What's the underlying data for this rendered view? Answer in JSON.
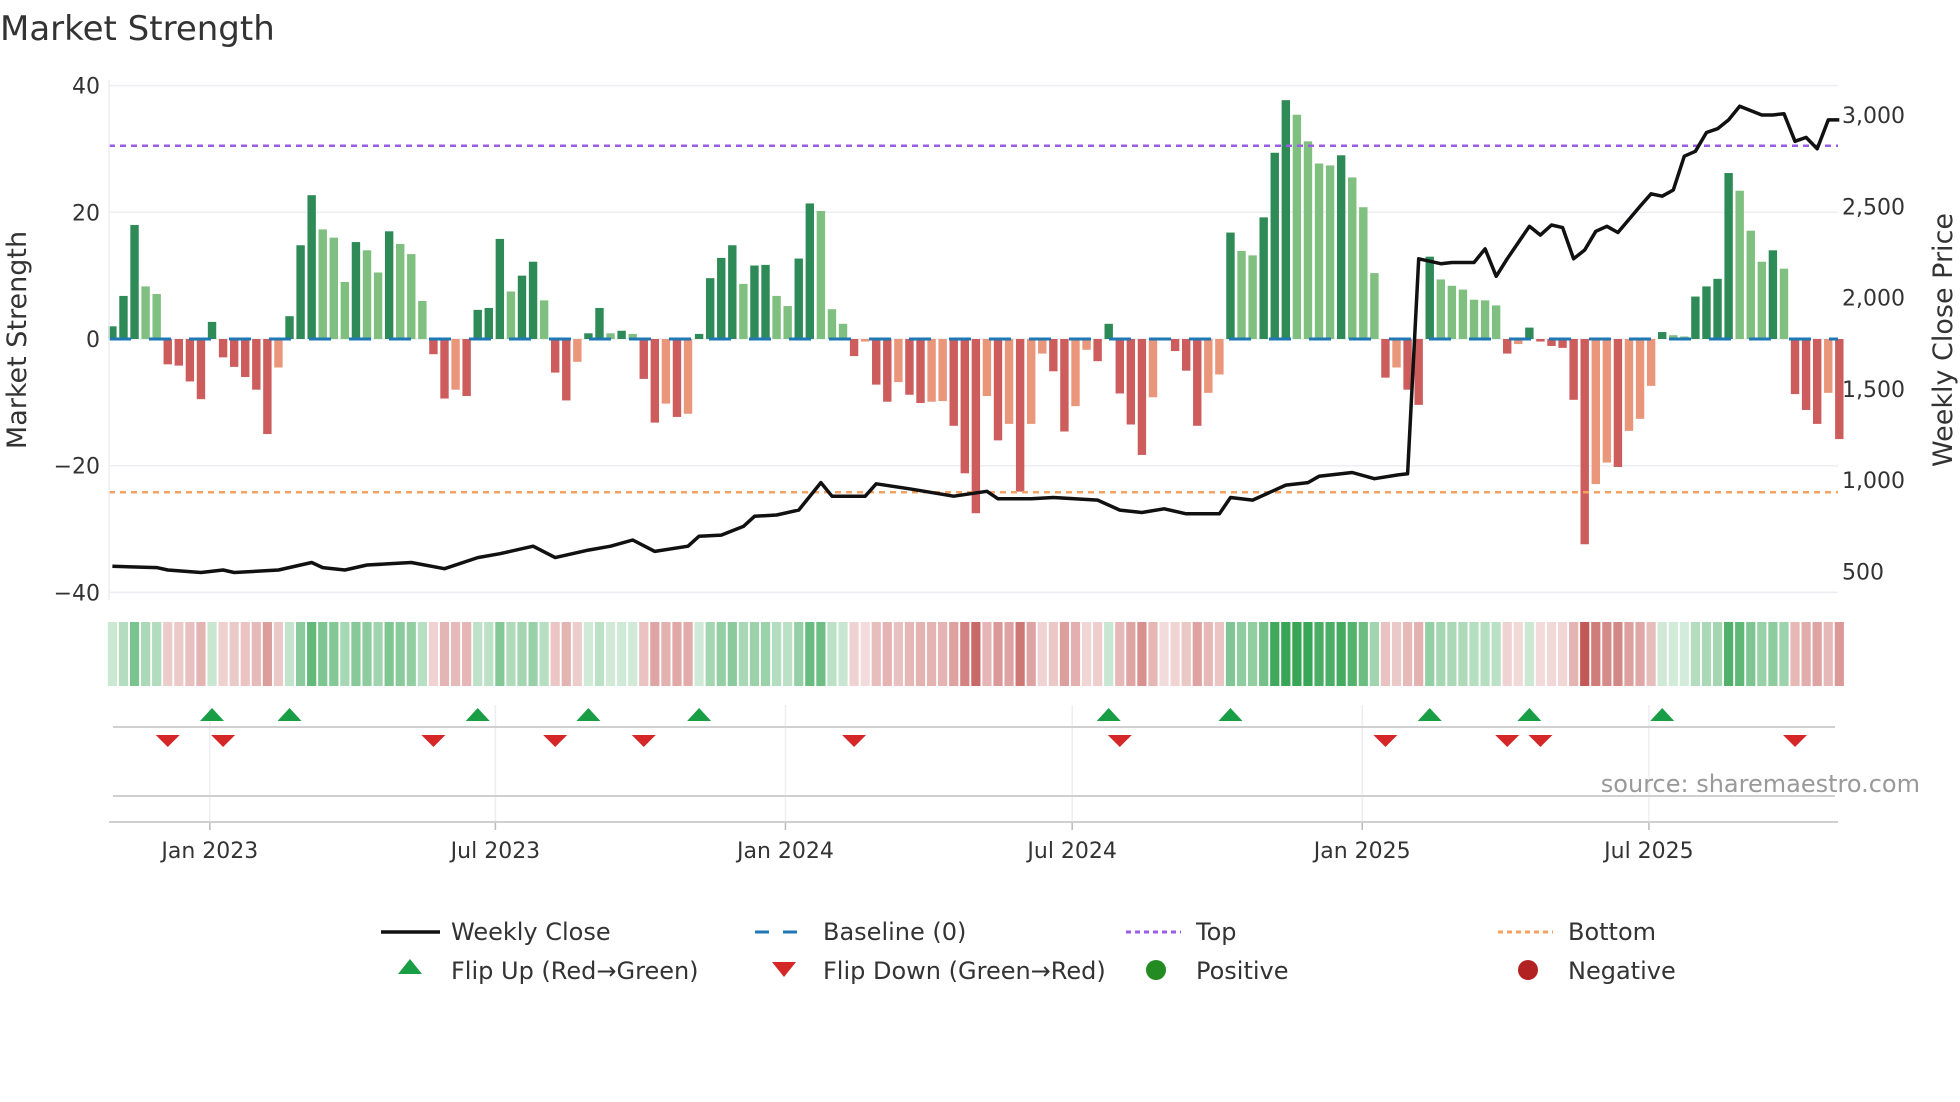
{
  "chart_data": {
    "type": "bar",
    "title": "Market Strength",
    "ylabel": "Market Strength",
    "y2label": "Weekly Close Price",
    "ylim": [
      -40,
      40
    ],
    "y2lim": [
      500,
      3000
    ],
    "yticks": [
      "40",
      "20",
      "0",
      "−20",
      "−40"
    ],
    "ytick_values": [
      40,
      20,
      0,
      -20,
      -40
    ],
    "y2ticks": [
      "3,000",
      "2,500",
      "2,000",
      "1,500",
      "1,000",
      "500"
    ],
    "y2tick_values": [
      3000,
      2500,
      2000,
      1500,
      1000,
      500
    ],
    "xticks": [
      {
        "label": "Jan 2023",
        "week": 8.8
      },
      {
        "label": "Jul 2023",
        "week": 34.6
      },
      {
        "label": "Jan 2024",
        "week": 60.8
      },
      {
        "label": "Jul 2024",
        "week": 86.7
      },
      {
        "label": "Jan 2025",
        "week": 112.9
      },
      {
        "label": "Jul 2025",
        "week": 138.8
      }
    ],
    "top_level": 30.5,
    "bottom_level": -24.2,
    "baseline": 0,
    "strength_values": [
      2,
      6.8,
      18,
      8.3,
      7.1,
      -4,
      -4.2,
      -6.7,
      -9.5,
      2.7,
      -2.9,
      -4.4,
      -6,
      -8,
      -15,
      -4.5,
      3.6,
      14.8,
      22.7,
      17.3,
      16,
      9,
      15.3,
      14,
      10.5,
      17,
      15,
      13.4,
      6,
      -2.4,
      -9.4,
      -8,
      -9,
      4.6,
      4.9,
      15.8,
      7.5,
      10,
      12.2,
      6.1,
      -5.3,
      -9.7,
      -3.6,
      0.9,
      4.9,
      0.9,
      1.3,
      0.8,
      -6.3,
      -13.2,
      -10.2,
      -12.3,
      -11.8,
      0.8,
      9.6,
      12.8,
      14.8,
      8.7,
      11.6,
      11.7,
      6.8,
      5.2,
      12.7,
      21.4,
      20.2,
      4.7,
      2.4,
      -2.7,
      -0.4,
      -7.2,
      -9.9,
      -6.8,
      -8.8,
      -10.1,
      -9.9,
      -9.8,
      -13.7,
      -21.2,
      -27.5,
      -9,
      -16,
      -13.4,
      -24.1,
      -13.4,
      -2.3,
      -5.1,
      -14.6,
      -10.6,
      -1.7,
      -3.5,
      2.4,
      -8.6,
      -13.5,
      -18.3,
      -9.2,
      -0.2,
      -1.9,
      -5,
      -13.7,
      -8.5,
      -5.6,
      16.8,
      13.9,
      13.2,
      19.2,
      29.4,
      37.7,
      35.4,
      31.2,
      27.7,
      27.4,
      29,
      25.5,
      20.8,
      10.4,
      -6.1,
      -4.5,
      -8,
      -10.4,
      13,
      9.4,
      8.4,
      7.8,
      6.2,
      6.1,
      5.3,
      -2.3,
      -0.8,
      1.8,
      -0.4,
      -1.1,
      -1.4,
      -9.6,
      -32.4,
      -22.9,
      -19.5,
      -20.2,
      -14.5,
      -12.6,
      -7.4,
      1.1,
      0.6,
      0.4,
      6.7,
      8.3,
      9.5,
      26.2,
      23.4,
      17.1,
      12.2,
      14,
      11.1,
      -8.7,
      -11.2,
      -13.4,
      -8.5,
      -15.8
    ],
    "weekly_close": [
      [
        0,
        527
      ],
      [
        4,
        520
      ],
      [
        5,
        507
      ],
      [
        8,
        493
      ],
      [
        10,
        507
      ],
      [
        11,
        493
      ],
      [
        15,
        507
      ],
      [
        18,
        548
      ],
      [
        19,
        520
      ],
      [
        21,
        507
      ],
      [
        23,
        534
      ],
      [
        25,
        541
      ],
      [
        27,
        548
      ],
      [
        30,
        514
      ],
      [
        33,
        575
      ],
      [
        35,
        596
      ],
      [
        38,
        637
      ],
      [
        40,
        575
      ],
      [
        43,
        616
      ],
      [
        45,
        637
      ],
      [
        47,
        671
      ],
      [
        49,
        609
      ],
      [
        52,
        637
      ],
      [
        53,
        692
      ],
      [
        55,
        698
      ],
      [
        57,
        746
      ],
      [
        58,
        801
      ],
      [
        60,
        808
      ],
      [
        62,
        835
      ],
      [
        64,
        986
      ],
      [
        65,
        911
      ],
      [
        68,
        911
      ],
      [
        69,
        979
      ],
      [
        72,
        952
      ],
      [
        76,
        911
      ],
      [
        79,
        938
      ],
      [
        80,
        897
      ],
      [
        83,
        897
      ],
      [
        85,
        904
      ],
      [
        89,
        890
      ],
      [
        91,
        835
      ],
      [
        93,
        822
      ],
      [
        95,
        842
      ],
      [
        97,
        815
      ],
      [
        100,
        815
      ],
      [
        101,
        904
      ],
      [
        103,
        890
      ],
      [
        106,
        972
      ],
      [
        108,
        986
      ],
      [
        109,
        1020
      ],
      [
        112,
        1041
      ],
      [
        114,
        1007
      ],
      [
        116,
        1027
      ],
      [
        117,
        1034
      ],
      [
        118,
        2212
      ],
      [
        120,
        2185
      ],
      [
        121,
        2192
      ],
      [
        123,
        2192
      ],
      [
        124,
        2267
      ],
      [
        125,
        2116
      ],
      [
        126,
        2212
      ],
      [
        128,
        2390
      ],
      [
        129,
        2342
      ],
      [
        130,
        2397
      ],
      [
        131,
        2383
      ],
      [
        132,
        2212
      ],
      [
        133,
        2260
      ],
      [
        134,
        2363
      ],
      [
        135,
        2390
      ],
      [
        136,
        2356
      ],
      [
        138,
        2500
      ],
      [
        139,
        2568
      ],
      [
        140,
        2555
      ],
      [
        141,
        2589
      ],
      [
        142,
        2774
      ],
      [
        143,
        2801
      ],
      [
        144,
        2904
      ],
      [
        145,
        2925
      ],
      [
        146,
        2973
      ],
      [
        147,
        3048
      ],
      [
        149,
        3000
      ],
      [
        150,
        3000
      ],
      [
        151,
        3007
      ],
      [
        152,
        2856
      ],
      [
        153,
        2877
      ],
      [
        154,
        2815
      ],
      [
        155,
        2973
      ],
      [
        156,
        2973
      ]
    ],
    "flip_up_weeks": [
      9,
      16,
      33,
      43,
      53,
      90,
      101,
      119,
      128,
      140
    ],
    "flip_down_weeks": [
      5,
      10,
      29,
      40,
      48,
      67,
      91,
      115,
      126,
      129,
      152
    ],
    "colors": {
      "green_rising": "#2e8b57",
      "green_falling": "#7fbf7f",
      "red_falling": "#cd5c5c",
      "red_rising": "#e9967a",
      "strip_green": "#2ca04c",
      "strip_red": "#c0504d",
      "baseline": "#1f77b4",
      "top": "#9b5de5",
      "bottom": "#f4a261",
      "flip_up": "#1a9e45",
      "flip_down": "#d62728",
      "positive": "#228b22",
      "negative": "#b22222"
    },
    "legend": {
      "weekly_close": "Weekly Close",
      "baseline": "Baseline (0)",
      "top": "Top",
      "bottom": "Bottom",
      "flip_up": "Flip Up (Red→Green)",
      "flip_down": "Flip Down (Green→Red)",
      "positive": "Positive",
      "negative": "Negative"
    },
    "legend_position": "bottom"
  },
  "source": "source: sharemaestro.com"
}
